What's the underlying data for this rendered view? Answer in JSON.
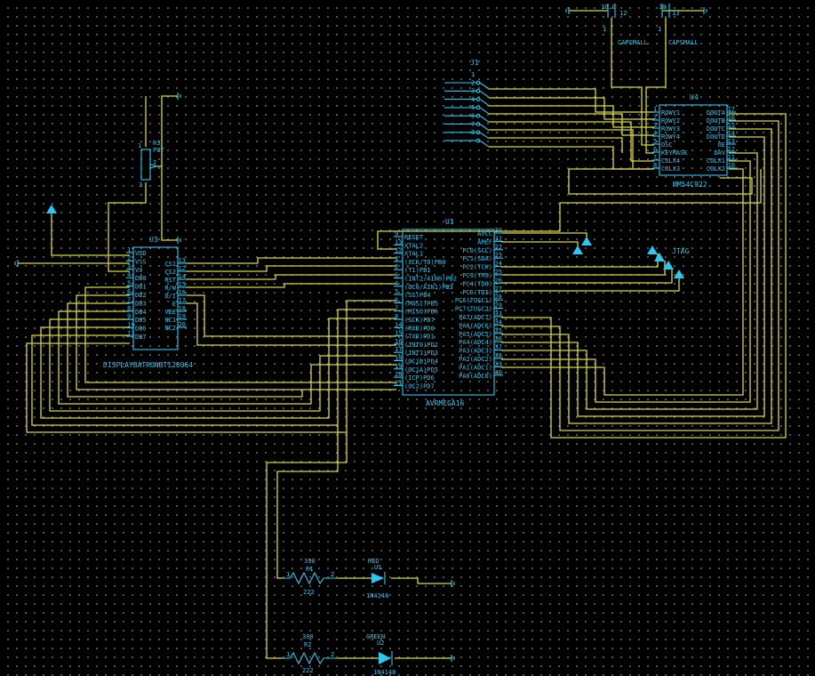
{
  "u1": {
    "ref": "U1",
    "part": "AVRMEGA16",
    "left_pins": [
      {
        "num": "9",
        "name": "RESET"
      },
      {
        "num": "13",
        "name": "XTAL2"
      },
      {
        "num": "12",
        "name": "XTAL1"
      },
      {
        "num": "1",
        "name": "(XCK/T0)PB0"
      },
      {
        "num": "2",
        "name": "(T1)PB1"
      },
      {
        "num": "3",
        "name": "(INT2/AIN0)PB2"
      },
      {
        "num": "4",
        "name": "(OC0/AIN1)PB3"
      },
      {
        "num": "5",
        "name": "(SS)PB4"
      },
      {
        "num": "6",
        "name": "(MOSI)PB5"
      },
      {
        "num": "7",
        "name": "(MISO)PB6"
      },
      {
        "num": "8",
        "name": "(SCK)PB7"
      },
      {
        "num": "14",
        "name": "(RXD)PD0"
      },
      {
        "num": "15",
        "name": "(TXD)PD1"
      },
      {
        "num": "16",
        "name": "(INT0)PD2"
      },
      {
        "num": "17",
        "name": "(INT1)PD3"
      },
      {
        "num": "18",
        "name": "(OC1B)PD4"
      },
      {
        "num": "19",
        "name": "(OC1A)PD5"
      },
      {
        "num": "20",
        "name": "(ICP)PD6"
      },
      {
        "num": "21",
        "name": "(OC2)PD7"
      }
    ],
    "right_pins": [
      {
        "num": "30",
        "name": "AVCC"
      },
      {
        "num": "32",
        "name": "AREF"
      },
      {
        "num": "22",
        "name": "PC0(SCL)"
      },
      {
        "num": "23",
        "name": "PC1(SDA)"
      },
      {
        "num": "24",
        "name": "PC2(TCK)"
      },
      {
        "num": "25",
        "name": "PC3(TMS)"
      },
      {
        "num": "26",
        "name": "PC4(TDO)"
      },
      {
        "num": "27",
        "name": "PC5(TDI)"
      },
      {
        "num": "28",
        "name": "PC6(TOSC1)"
      },
      {
        "num": "29",
        "name": "PC7(TOSC2)"
      },
      {
        "num": "33",
        "name": "PA7(ADC7)"
      },
      {
        "num": "34",
        "name": "PA6(ADC6)"
      },
      {
        "num": "35",
        "name": "PA5(ADC5)"
      },
      {
        "num": "36",
        "name": "PA4(ADC4)"
      },
      {
        "num": "37",
        "name": "PA3(ADC3)"
      },
      {
        "num": "38",
        "name": "PA2(ADC2)"
      },
      {
        "num": "39",
        "name": "PA1(ADC1)"
      },
      {
        "num": "40",
        "name": "PA0(ADC0)"
      }
    ]
  },
  "u3": {
    "ref": "U3",
    "part": "DISPLAYBATRONBT128064",
    "left_pins": [
      {
        "num": "1",
        "name": "VDD"
      },
      {
        "num": "2",
        "name": "VSS"
      },
      {
        "num": "3",
        "name": "V0"
      },
      {
        "num": "4",
        "name": "DB0"
      },
      {
        "num": "5",
        "name": "DB1"
      },
      {
        "num": "6",
        "name": "DB2"
      },
      {
        "num": "7",
        "name": "DB3"
      },
      {
        "num": "8",
        "name": "DB4"
      },
      {
        "num": "9",
        "name": "DB5"
      },
      {
        "num": "10",
        "name": "DB6"
      },
      {
        "num": "11",
        "name": "DB7"
      }
    ],
    "right_pins": [
      {
        "num": "13",
        "name": "CS1"
      },
      {
        "num": "12",
        "name": "CS2"
      },
      {
        "num": "14",
        "name": "RST"
      },
      {
        "num": "15",
        "name": "R/W"
      },
      {
        "num": "16",
        "name": "D/I"
      },
      {
        "num": "17",
        "name": "E"
      },
      {
        "num": "18",
        "name": "VEE"
      },
      {
        "num": "19",
        "name": "NC1"
      },
      {
        "num": "20",
        "name": "NC2"
      }
    ]
  },
  "u4": {
    "ref": "U4",
    "part": "MM54C922",
    "left_pins": [
      {
        "num": "1",
        "name": "ROWY1"
      },
      {
        "num": "2",
        "name": "ROWY2"
      },
      {
        "num": "3",
        "name": "ROWY3"
      },
      {
        "num": "4",
        "name": "ROWY4"
      },
      {
        "num": "5",
        "name": "OSC"
      },
      {
        "num": "6",
        "name": "KEYMASK"
      },
      {
        "num": "7",
        "name": "COLX4"
      },
      {
        "num": "8",
        "name": "COLX3"
      }
    ],
    "right_pins": [
      {
        "num": "17",
        "name": "DOUTA"
      },
      {
        "num": "16",
        "name": "DOUTB"
      },
      {
        "num": "15",
        "name": "DOUTC"
      },
      {
        "num": "14",
        "name": "DOUTD"
      },
      {
        "num": "13",
        "name": "OE"
      },
      {
        "num": "12",
        "name": "DAV"
      },
      {
        "num": "11",
        "name": "COLX1"
      },
      {
        "num": "10",
        "name": "COLX2"
      }
    ]
  },
  "j1": {
    "ref": "J1",
    "pins": [
      "1",
      "2",
      "3",
      "4",
      "5",
      "6",
      "7",
      "8"
    ]
  },
  "r3": {
    "ref": "R3",
    "value": "POT",
    "pin1": "1",
    "pin2": "2",
    "pin3": "3"
  },
  "c2": {
    "ref": "12",
    "pin1": "10.0",
    "pin2": "1",
    "label": "CAPSMALL"
  },
  "c3": {
    "ref": "13",
    "pin1": "10",
    "pin2": "1",
    "label": "CAPSMALL"
  },
  "jtag": {
    "label": "JTAG"
  },
  "r1": {
    "value": "390",
    "ref": "R1",
    "pin1": "1",
    "pin2": "2",
    "footprint": "222"
  },
  "d1": {
    "value": "RED",
    "ref": "U1",
    "part": "1N4148"
  },
  "r2": {
    "value": "390",
    "ref": "R2",
    "pin1": "1",
    "pin2": "2",
    "footprint": "222"
  },
  "d2": {
    "value": "GREEN",
    "ref": "U2",
    "part": "1N4148"
  },
  "colors": {
    "wire": "#d8d63a",
    "component": "#2ec6f0",
    "background": "#000000",
    "grid_dot": "#6a6a6a"
  }
}
